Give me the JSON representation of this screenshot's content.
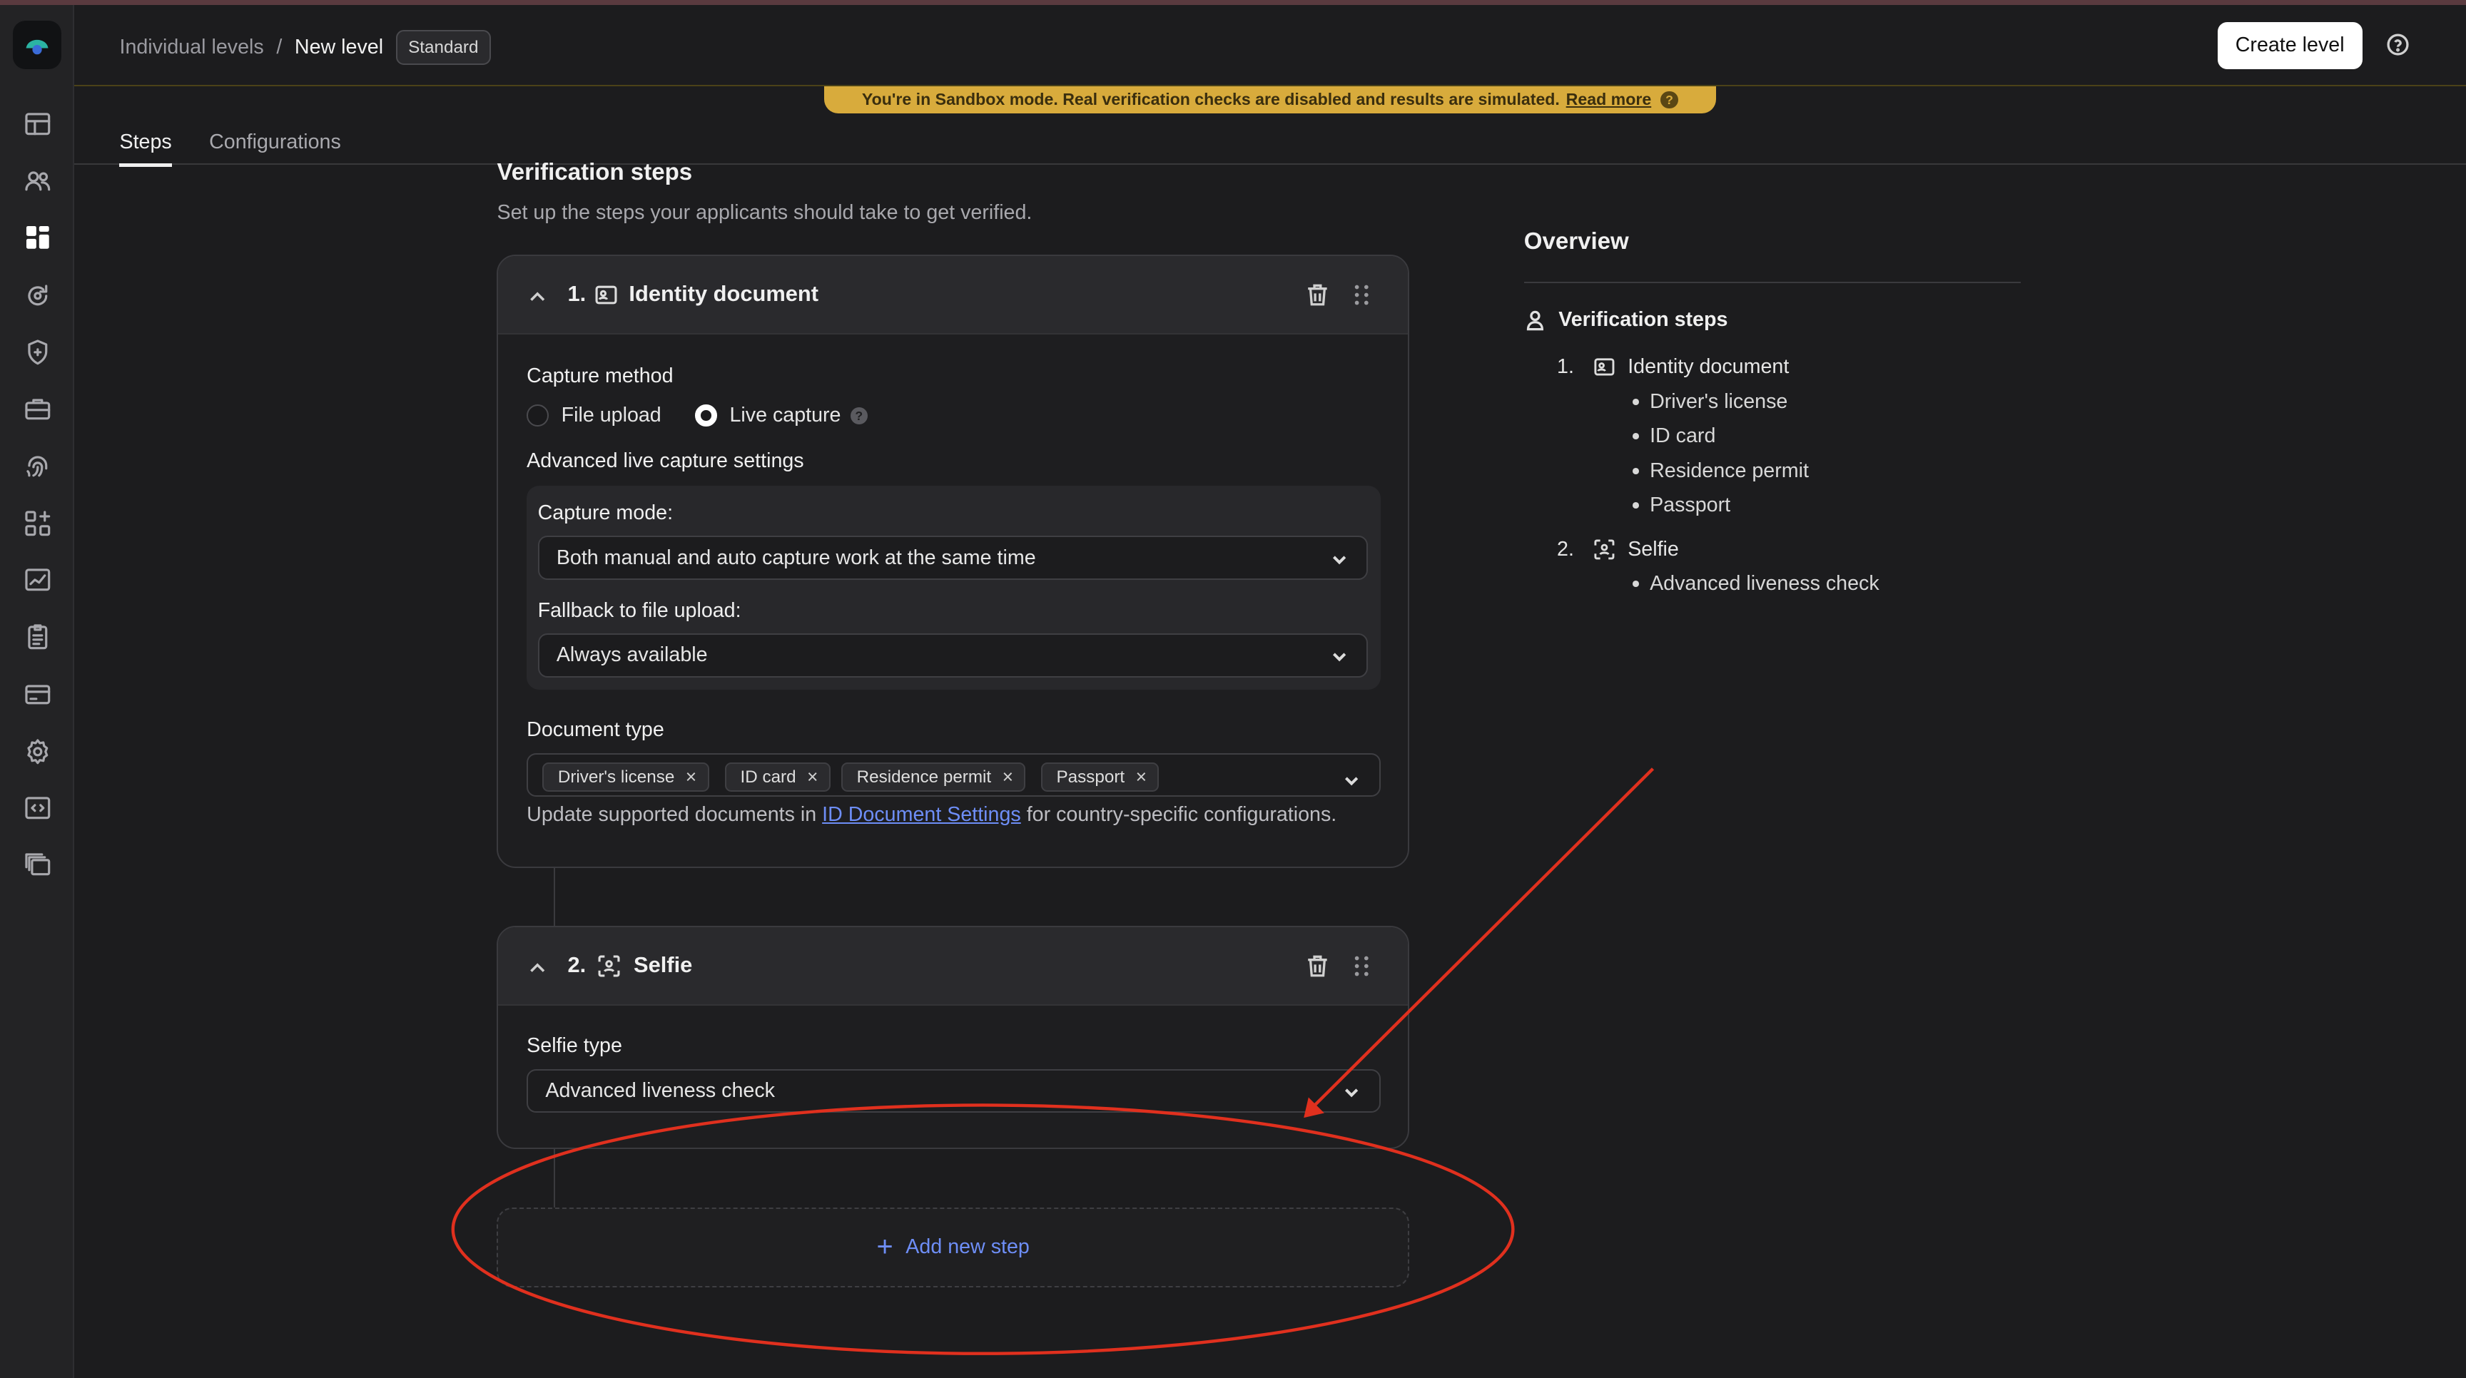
{
  "header": {
    "breadcrumb_parent": "Individual levels",
    "breadcrumb_sep": "/",
    "breadcrumb_current": "New level",
    "level_badge": "Standard",
    "create_button": "Create level"
  },
  "sandbox_banner": {
    "text": "You're in Sandbox mode. Real verification checks are disabled and results are simulated.",
    "link": "Read more"
  },
  "tabs": [
    {
      "label": "Steps",
      "active": true
    },
    {
      "label": "Configurations",
      "active": false
    }
  ],
  "sidebar": {
    "icons": [
      "dashboard-icon",
      "users-icon",
      "levels-icon",
      "refresh-icon",
      "shield-icon",
      "briefcase-icon",
      "fingerprint-icon",
      "apps-icon",
      "chart-icon",
      "clipboard-icon",
      "card-icon",
      "settings-icon",
      "code-icon",
      "layers-icon"
    ],
    "active": "levels-icon"
  },
  "main": {
    "title": "Verification steps",
    "subtitle": "Set up the steps your applicants should take to get verified.",
    "step1": {
      "number": "1.",
      "title": "Identity document",
      "capture_method_label": "Capture method",
      "options": [
        "File upload",
        "Live capture"
      ],
      "selected_option": "Live capture",
      "advanced_label": "Advanced live capture settings",
      "capture_mode_label": "Capture mode:",
      "capture_mode_value": "Both manual and auto capture work at the same time",
      "fallback_label": "Fallback to file upload:",
      "fallback_value": "Always available",
      "doc_type_label": "Document type",
      "doc_types": [
        "Driver's license",
        "ID card",
        "Residence permit",
        "Passport"
      ],
      "note_prefix": "Update supported documents in",
      "note_link": "ID Document Settings",
      "note_suffix": "for country-specific configurations."
    },
    "step2": {
      "number": "2.",
      "title": "Selfie",
      "selfie_type_label": "Selfie type",
      "selfie_type_value": "Advanced liveness check"
    },
    "add_step": "Add new step"
  },
  "overview": {
    "title": "Overview",
    "section": "Verification steps",
    "steps": [
      {
        "number": "1.",
        "name": "Identity document",
        "items": [
          "Driver's license",
          "ID card",
          "Residence permit",
          "Passport"
        ]
      },
      {
        "number": "2.",
        "name": "Selfie",
        "items": [
          "Advanced liveness check"
        ]
      }
    ]
  },
  "colors": {
    "accent_link": "#6e8ef7",
    "sandbox_banner": "#d8ab3c",
    "annotation": "#e0301e"
  }
}
